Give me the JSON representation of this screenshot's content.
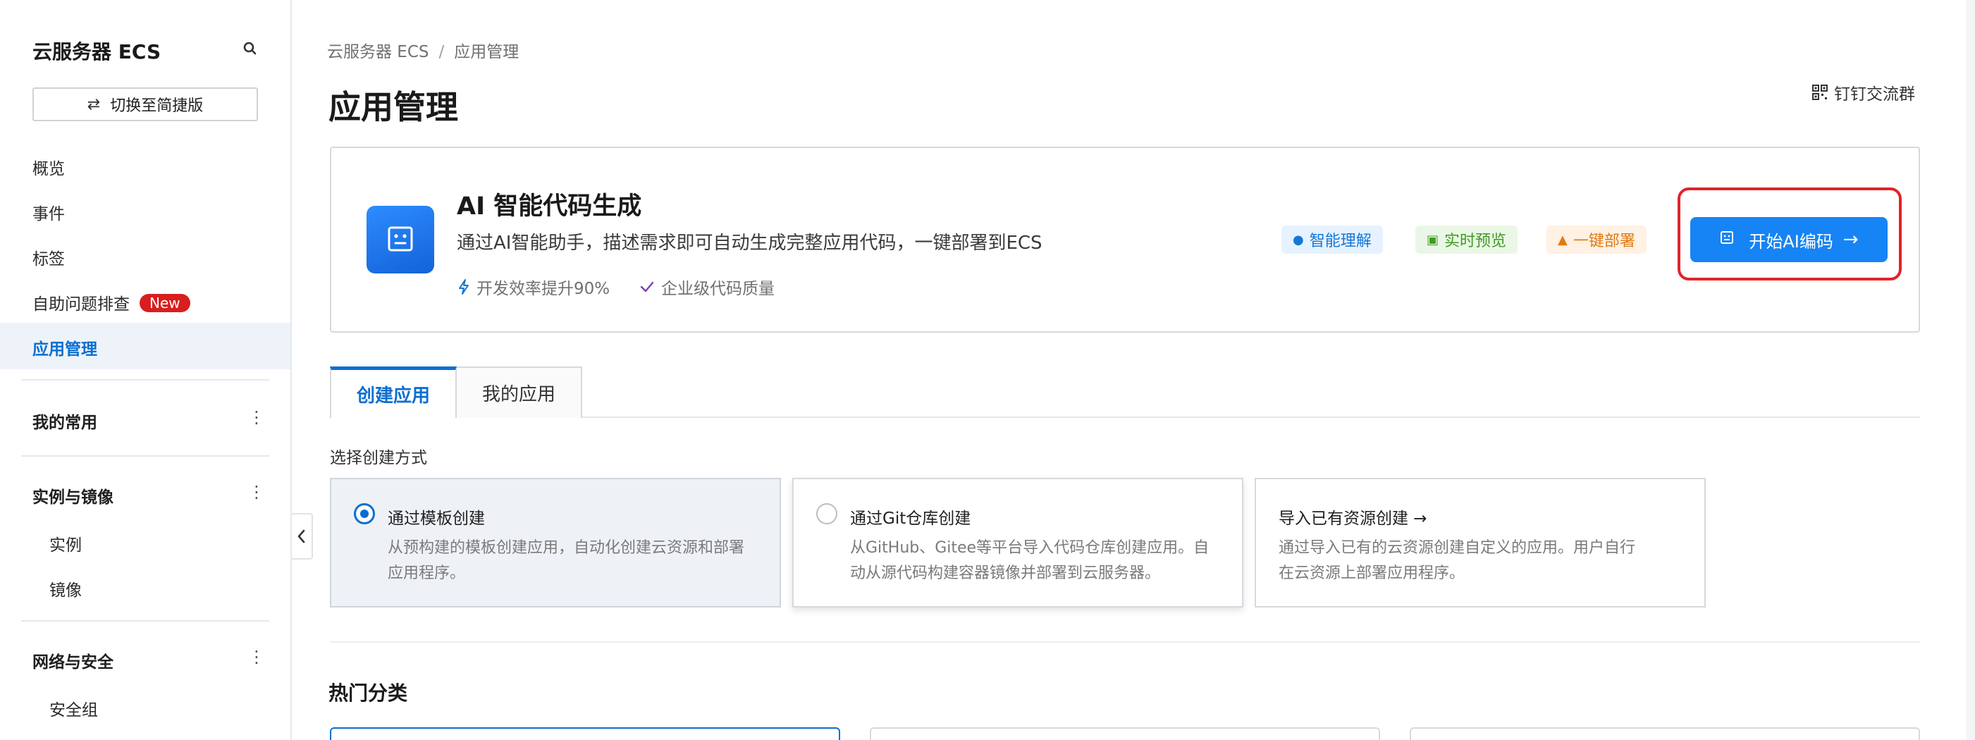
{
  "sidebar": {
    "title": "云服务器 ECS",
    "switch_label": "切换至简捷版",
    "items": [
      "概览",
      "事件",
      "标签",
      "自助问题排查",
      "应用管理"
    ],
    "new_badge": "New",
    "groups": [
      {
        "label": "我的常用",
        "children": []
      },
      {
        "label": "实例与镜像",
        "children": [
          "实例",
          "镜像"
        ]
      },
      {
        "label": "网络与安全",
        "children": [
          "安全组"
        ]
      }
    ]
  },
  "breadcrumb": {
    "root": "云服务器 ECS",
    "separator": "/",
    "current": "应用管理"
  },
  "page": {
    "title": "应用管理",
    "dingtalk_label": "钉钉交流群"
  },
  "ai_card": {
    "title": "AI 智能代码生成",
    "description": "通过AI智能助手，描述需求即可自动生成完整应用代码，一键部署到ECS",
    "features": [
      "开发效率提升90%",
      "企业级代码质量"
    ],
    "tags": [
      "智能理解",
      "实时预览",
      "一键部署"
    ],
    "button_label": "开始AI编码",
    "colors": {
      "button": "#1784f5",
      "highlight_frame": "#e0242b"
    }
  },
  "tabs": [
    {
      "label": "创建应用",
      "active": true
    },
    {
      "label": "我的应用",
      "active": false
    }
  ],
  "create": {
    "section_label": "选择创建方式",
    "options": [
      {
        "title": "通过模板创建",
        "desc": "从预构建的模板创建应用，自动化创建云资源和部署应用程序。",
        "selected": true
      },
      {
        "title": "通过Git仓库创建",
        "desc": "从GitHub、Gitee等平台导入代码仓库创建应用。自动从源代码构建容器镜像并部署到云服务器。",
        "selected": false
      },
      {
        "title": "导入已有资源创建 →",
        "desc": "通过导入已有的云资源创建自定义的应用。用户自行在云资源上部署应用程序。",
        "selected": false
      }
    ]
  },
  "hot": {
    "title": "热门分类"
  },
  "icons": [
    "search-icon",
    "switch-icon",
    "more-icon",
    "chevron-left-icon",
    "qrcode-icon",
    "robot-icon",
    "bolt-icon",
    "check-icon",
    "bulb-icon",
    "terminal-icon",
    "rocket-icon",
    "arrow-right-icon"
  ]
}
